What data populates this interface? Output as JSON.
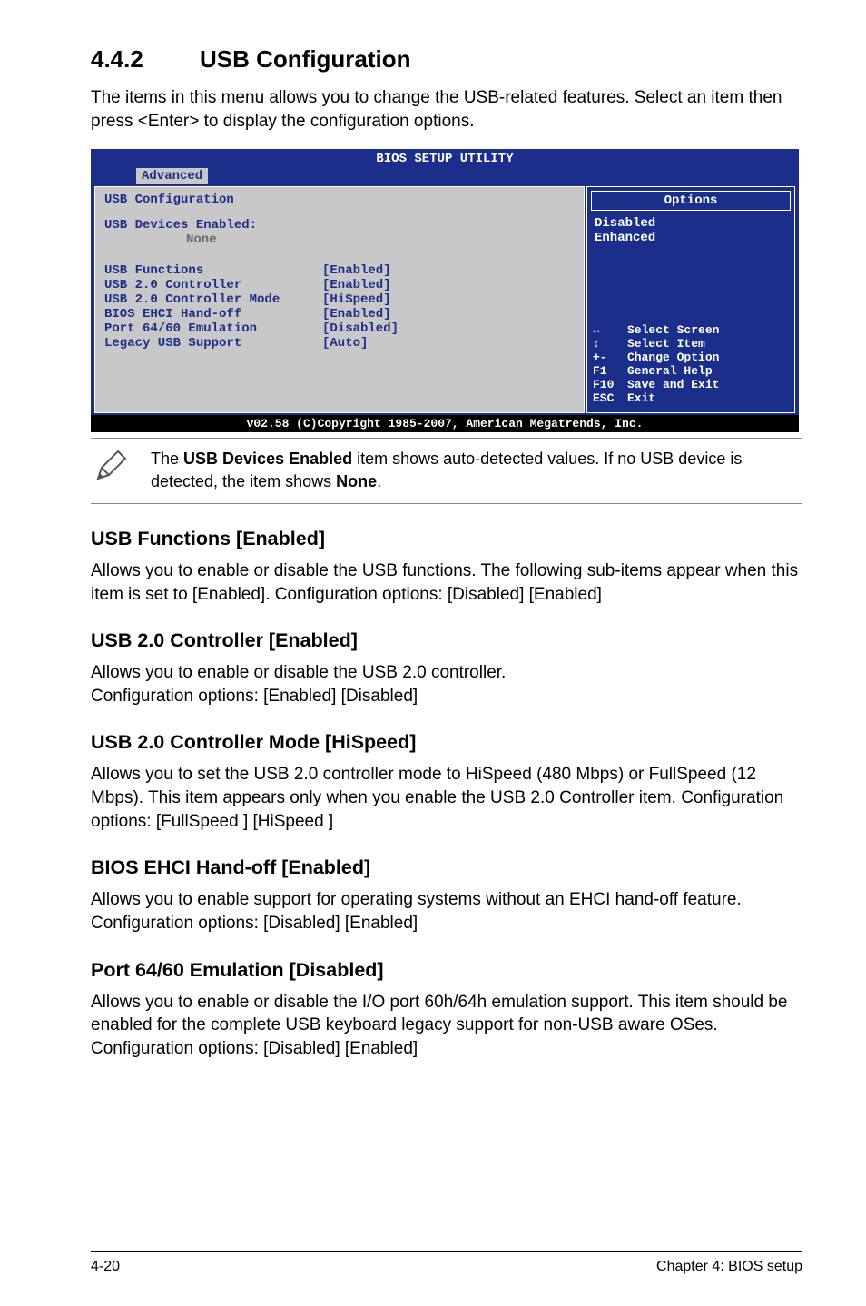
{
  "section": {
    "number": "4.4.2",
    "title": "USB Configuration"
  },
  "intro": "The items in this menu allows you to change the USB-related features. Select an item then press <Enter> to display the configuration options.",
  "bios": {
    "title": "BIOS SETUP UTILITY",
    "tab_active": "Advanced",
    "left_header": "USB Configuration",
    "devices_label": "USB Devices Enabled:",
    "devices_value": "None",
    "rows": [
      {
        "label": "USB Functions",
        "value": "[Enabled]"
      },
      {
        "label": "USB 2.0 Controller",
        "value": "[Enabled]"
      },
      {
        "label": "USB 2.0 Controller Mode",
        "value": "[HiSpeed]"
      },
      {
        "label": "BIOS EHCI Hand-off",
        "value": "[Enabled]"
      },
      {
        "label": "Port 64/60 Emulation",
        "value": "[Disabled]"
      },
      {
        "label": "Legacy USB Support",
        "value": "[Auto]"
      }
    ],
    "options_header": "Options",
    "options": [
      "Disabled",
      "Enhanced"
    ],
    "help": [
      {
        "icon": "↔",
        "text": "Select Screen"
      },
      {
        "icon": "↕",
        "text": "Select Item"
      },
      {
        "icon": "+-",
        "text": "Change Option"
      },
      {
        "icon": "F1",
        "text": "General Help"
      },
      {
        "icon": "F10",
        "text": "Save and Exit"
      },
      {
        "icon": "ESC",
        "text": "Exit"
      }
    ],
    "footer": "v02.58 (C)Copyright 1985-2007, American Megatrends, Inc."
  },
  "note": {
    "text_pre": "The ",
    "bold1": "USB Devices Enabled",
    "text_mid": " item shows auto-detected values. If no USB device is detected, the item shows ",
    "bold2": "None",
    "text_post": "."
  },
  "subsections": {
    "usb_functions": {
      "title": "USB Functions [Enabled]",
      "text": "Allows you to enable or disable the USB functions. The following sub-items appear when this item is set to [Enabled]. Configuration options: [Disabled] [Enabled]"
    },
    "usb20_controller": {
      "title": "USB 2.0 Controller [Enabled]",
      "text": "Allows you to enable or disable the USB 2.0 controller.\nConfiguration options: [Enabled] [Disabled]"
    },
    "usb20_mode": {
      "title": "USB 2.0 Controller Mode [HiSpeed]",
      "text": "Allows you to set the USB 2.0 controller mode to HiSpeed (480 Mbps) or FullSpeed (12 Mbps). This item appears only when you enable the USB 2.0 Controller item. Configuration options: [FullSpeed ] [HiSpeed ]"
    },
    "ehci": {
      "title": "BIOS EHCI Hand-off [Enabled]",
      "text": "Allows you to enable support for operating systems without an EHCI hand-off feature. Configuration options: [Disabled] [Enabled]"
    },
    "port6460": {
      "title": "Port 64/60 Emulation [Disabled]",
      "text": "Allows you to enable or disable the I/O port 60h/64h emulation support. This item should be enabled for the complete USB keyboard legacy support for non-USB aware OSes. Configuration options: [Disabled] [Enabled]"
    }
  },
  "footer": {
    "left": "4-20",
    "right": "Chapter 4: BIOS setup"
  }
}
